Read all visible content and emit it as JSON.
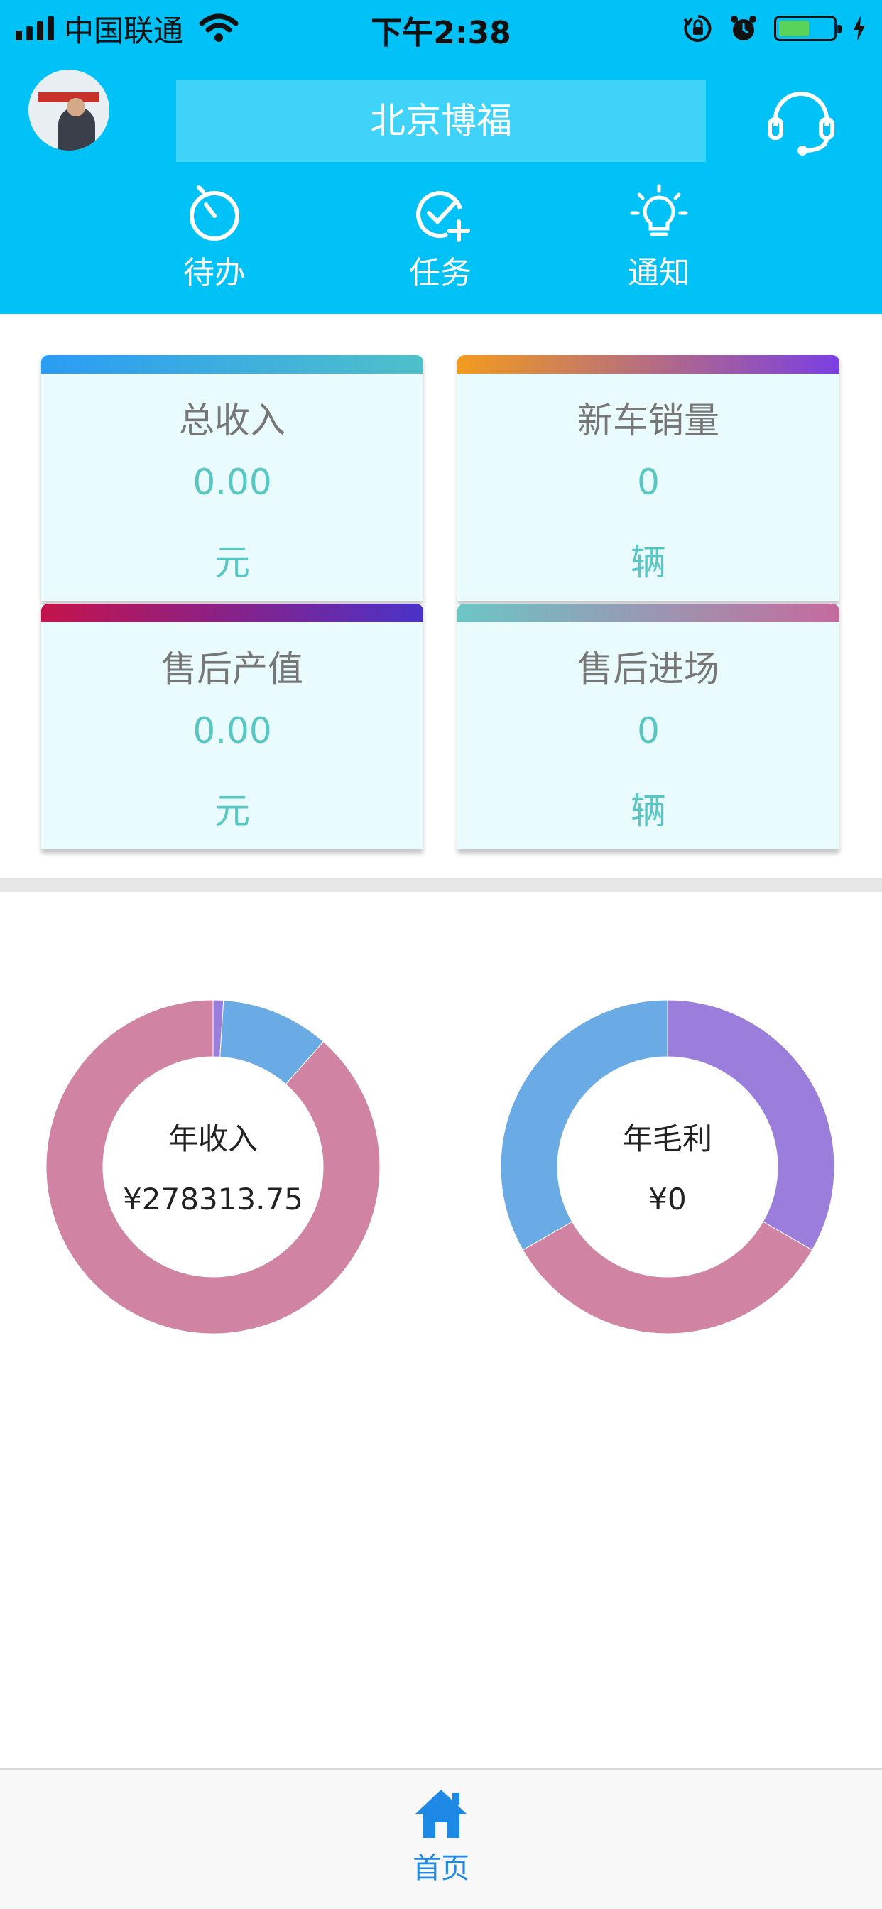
{
  "status_bar": {
    "carrier": "中国联通",
    "time": "下午2:38",
    "battery_level": 0.55,
    "icons": [
      "signal-icon",
      "wifi-icon",
      "orientation-lock-icon",
      "alarm-icon",
      "battery-icon",
      "charging-icon"
    ]
  },
  "header": {
    "title": "北京博福",
    "avatar_icon": "user-avatar",
    "support_icon": "headset-icon",
    "nav": [
      {
        "label": "待办",
        "icon": "timer-icon"
      },
      {
        "label": "任务",
        "icon": "task-add-icon"
      },
      {
        "label": "通知",
        "icon": "lightbulb-icon"
      }
    ]
  },
  "stats": [
    {
      "label": "总收入",
      "value": "0.00",
      "unit": "元",
      "accent": [
        "#2a9df4",
        "#4fc0c9"
      ]
    },
    {
      "label": "新车销量",
      "value": "0",
      "unit": "辆",
      "accent": [
        "#f29b1d",
        "#7a3fe4"
      ]
    },
    {
      "label": "售后产值",
      "value": "0.00",
      "unit": "元",
      "accent": [
        "#c4134b",
        "#4a32c8"
      ]
    },
    {
      "label": "售后进场",
      "value": "0",
      "unit": "辆",
      "accent": [
        "#6cc6c6",
        "#c56a9e"
      ]
    }
  ],
  "charts": [
    {
      "label": "年收入",
      "value": "¥278313.75"
    },
    {
      "label": "年毛利",
      "value": "¥0"
    }
  ],
  "chart_data": [
    {
      "type": "pie",
      "title": "年收入",
      "slices": [
        {
          "value": 1.0,
          "color": "#9b7ddb"
        },
        {
          "value": 10.5,
          "color": "#6aaae5"
        },
        {
          "value": 88.5,
          "color": "#d183a4"
        }
      ]
    },
    {
      "type": "pie",
      "title": "年毛利",
      "slices": [
        {
          "value": 33.3,
          "color": "#9b7ddb"
        },
        {
          "value": 33.4,
          "color": "#d183a4"
        },
        {
          "value": 33.3,
          "color": "#6aaae5"
        }
      ]
    }
  ],
  "tabbar": {
    "items": [
      {
        "label": "首页",
        "icon": "home-icon",
        "active": true
      }
    ],
    "active_color": "#1e88e5"
  },
  "colors": {
    "primary": "#00c2f6",
    "value_text": "#58c7c3"
  }
}
